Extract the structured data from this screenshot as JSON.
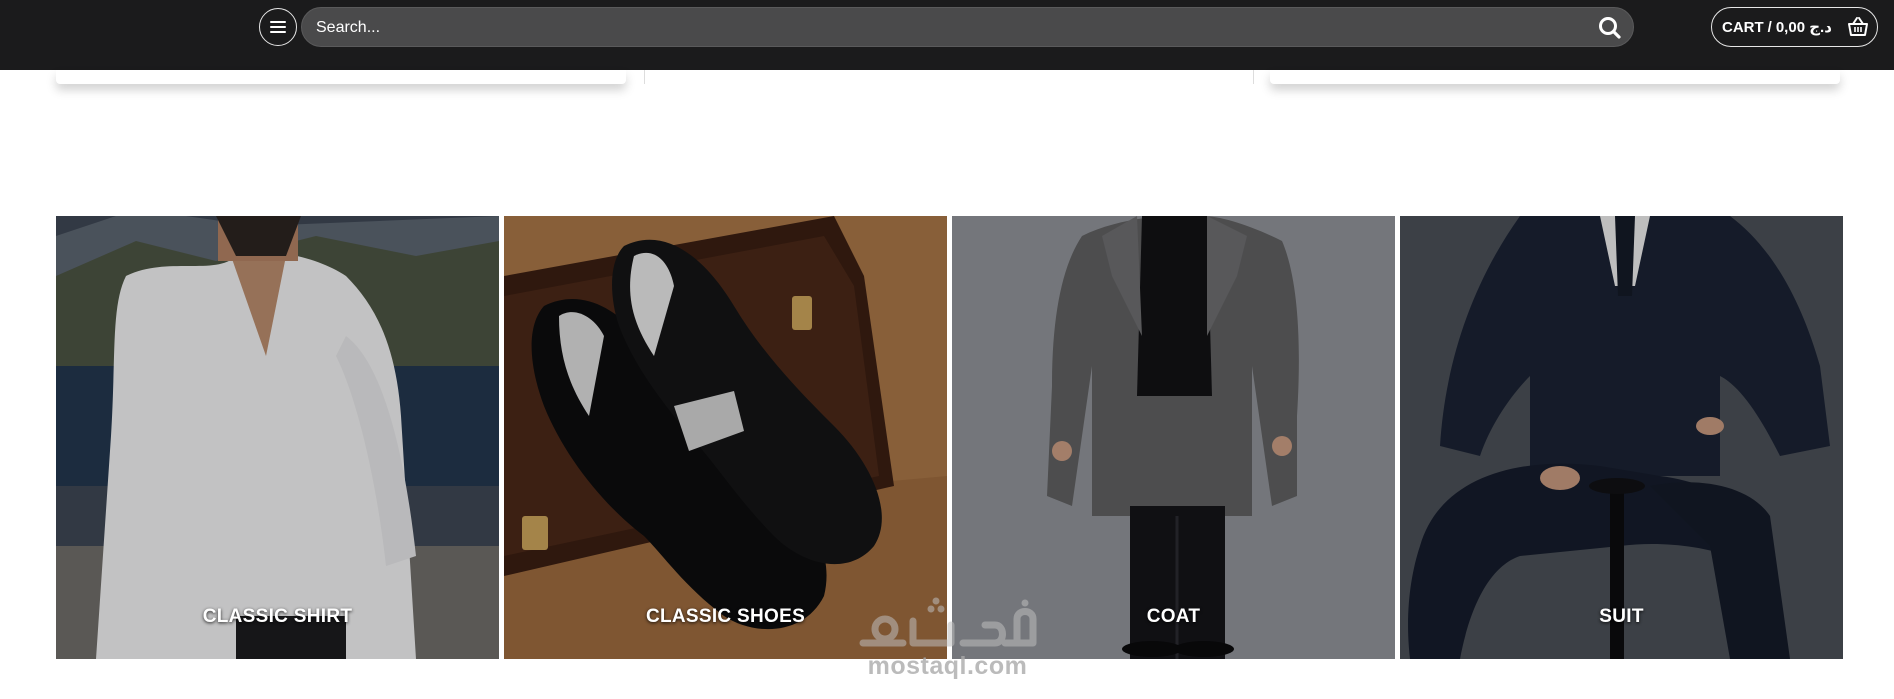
{
  "header": {
    "search": {
      "placeholder": "Search...",
      "value": ""
    },
    "cart": {
      "label": "CART",
      "separator": "/",
      "amount": "0,00 د.ج"
    }
  },
  "categories": [
    {
      "label": "CLASSIC SHIRT"
    },
    {
      "label": "CLASSIC SHOES"
    },
    {
      "label": "COAT"
    },
    {
      "label": "SUIT"
    }
  ],
  "watermark": {
    "logo": "مستقل",
    "text": "mostaql.com"
  },
  "colors": {
    "header_bg": "#1b1b1c",
    "search_bg": "#4a4a4b",
    "text_light": "#ffffff"
  },
  "icons": {
    "menu": "hamburger-icon",
    "search": "search-icon",
    "cart": "basket-icon"
  }
}
